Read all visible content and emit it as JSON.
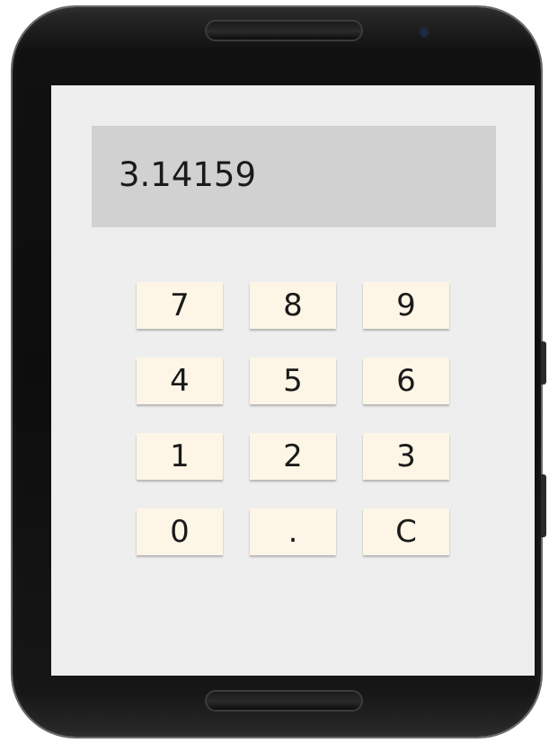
{
  "display": {
    "value": "3.14159"
  },
  "keypad": {
    "keys": [
      "7",
      "8",
      "9",
      "4",
      "5",
      "6",
      "1",
      "2",
      "3",
      "0",
      ".",
      "C"
    ]
  }
}
